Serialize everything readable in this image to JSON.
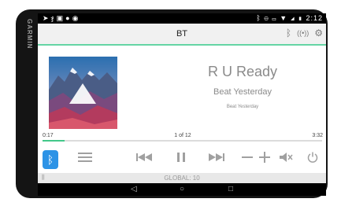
{
  "device": {
    "brand": "GARMIN"
  },
  "status_bar": {
    "left_icons": [
      "navigation-icon",
      "wifi-off-icon",
      "image-icon",
      "mic-icon",
      "location-icon"
    ],
    "right_icons": [
      "bluetooth-icon",
      "minus-circle-icon",
      "battery-saver-icon",
      "wifi-icon",
      "signal-icon",
      "battery-icon"
    ],
    "time": "2:12"
  },
  "top_bar": {
    "title": "BT"
  },
  "now_playing": {
    "title": "R U Ready",
    "artist": "Beat Yesterday",
    "album": "Beat Yesterday",
    "elapsed": "0:17",
    "track_counter": "1 of 12",
    "duration": "3:32",
    "progress_fraction": 0.08
  },
  "controls": {
    "source_icon": "bluetooth-icon",
    "menu_icon": "menu-icon",
    "prev_icon": "previous-track-icon",
    "pause_icon": "pause-icon",
    "next_icon": "next-track-icon",
    "volume_down_icon": "minus-icon",
    "volume_up_icon": "plus-icon",
    "mute_icon": "mute-icon",
    "power_icon": "power-icon"
  },
  "footer": {
    "global_label": "GLOBAL: 10"
  },
  "colors": {
    "accent": "#65d5a5",
    "progress": "#43c88a",
    "bt_button": "#2d93e6"
  }
}
